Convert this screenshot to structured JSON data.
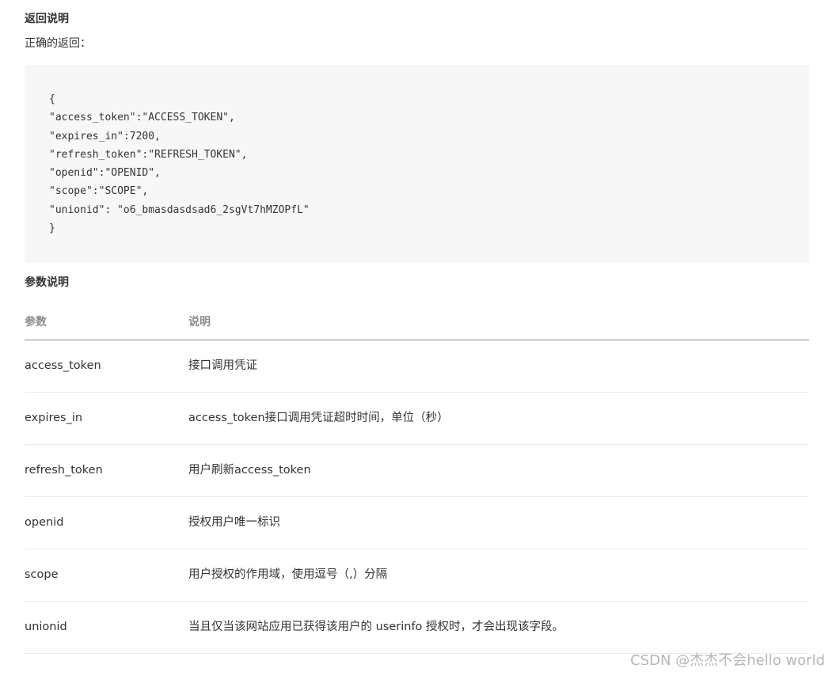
{
  "return_section": {
    "title": "返回说明",
    "intro": "正确的返回："
  },
  "code_lines": [
    "{",
    "\"access_token\":\"ACCESS_TOKEN\",",
    "\"expires_in\":7200,",
    "\"refresh_token\":\"REFRESH_TOKEN\",",
    "\"openid\":\"OPENID\",",
    "\"scope\":\"SCOPE\",",
    "\"unionid\": \"o6_bmasdasdsad6_2sgVt7hMZOPfL\"",
    "}"
  ],
  "params_section": {
    "title": "参数说明",
    "headers": [
      "参数",
      "说明"
    ],
    "rows": [
      {
        "param": "access_token",
        "desc": "接口调用凭证"
      },
      {
        "param": "expires_in",
        "desc": "access_token接口调用凭证超时时间，单位（秒）"
      },
      {
        "param": "refresh_token",
        "desc": "用户刷新access_token"
      },
      {
        "param": "openid",
        "desc": "授权用户唯一标识"
      },
      {
        "param": "scope",
        "desc": "用户授权的作用域，使用逗号（,）分隔"
      },
      {
        "param": "unionid",
        "desc": "当且仅当该网站应用已获得该用户的 userinfo 授权时，才会出现该字段。"
      }
    ]
  },
  "watermark": "CSDN @杰杰不会hello world"
}
